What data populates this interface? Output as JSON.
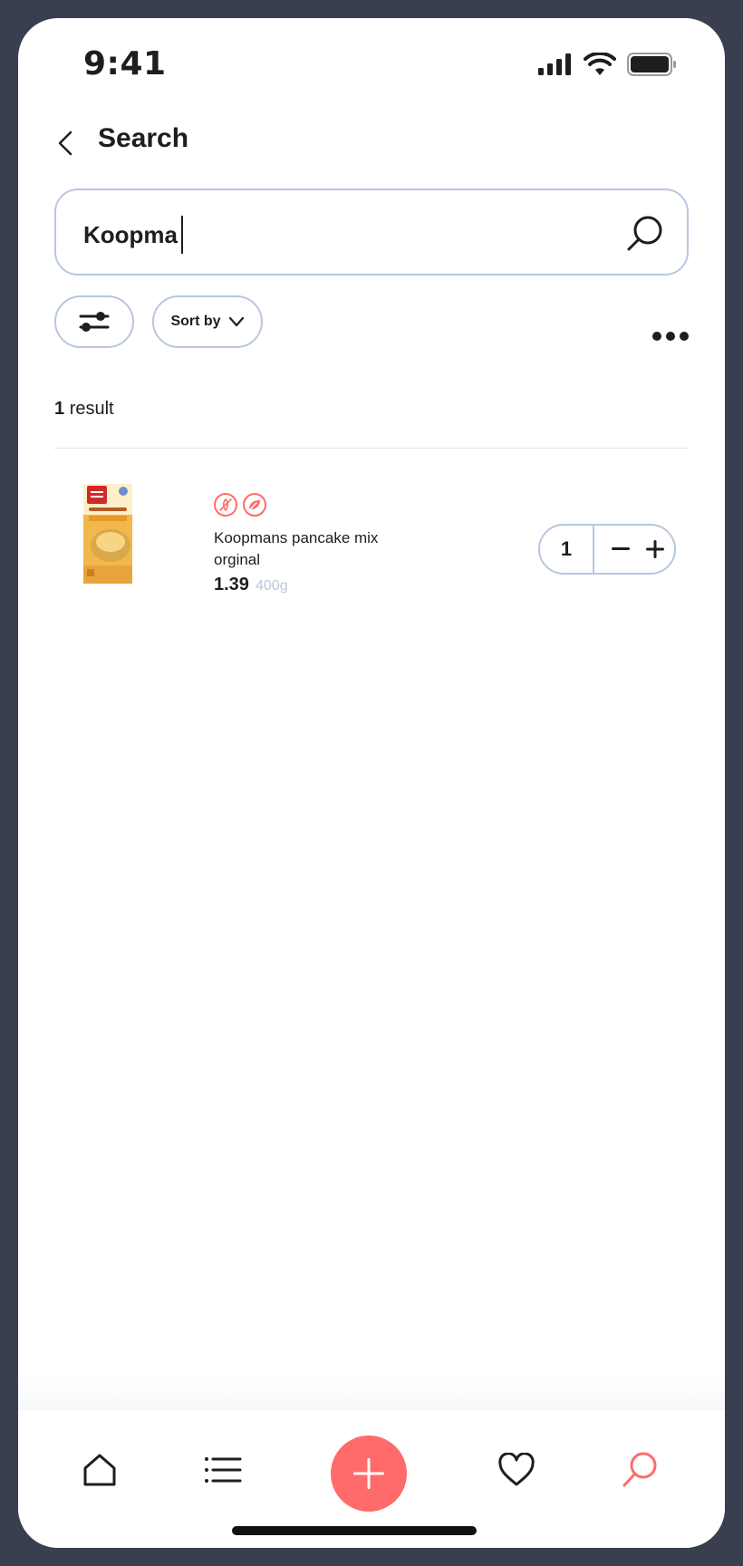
{
  "status_bar": {
    "time": "9:41"
  },
  "header": {
    "title": "Search"
  },
  "search": {
    "value": "Koopma"
  },
  "toolbar": {
    "sort_label": "Sort by"
  },
  "results": {
    "count": "1",
    "count_suffix": "result",
    "items": [
      {
        "name": "Koopmans pancake mix orginal",
        "price": "1.39",
        "weight": "400g",
        "quantity": "1",
        "badges": [
          "gluten-free-icon",
          "vegan-leaf-icon"
        ]
      }
    ]
  },
  "colors": {
    "accent": "#ff6b6b",
    "border": "#b8c7de",
    "text": "#1e1e1e",
    "frame": "#3a3f50"
  },
  "nav": {
    "items": [
      "home-icon",
      "list-icon",
      "add-icon",
      "heart-icon",
      "search-icon"
    ],
    "active": "search-icon"
  }
}
